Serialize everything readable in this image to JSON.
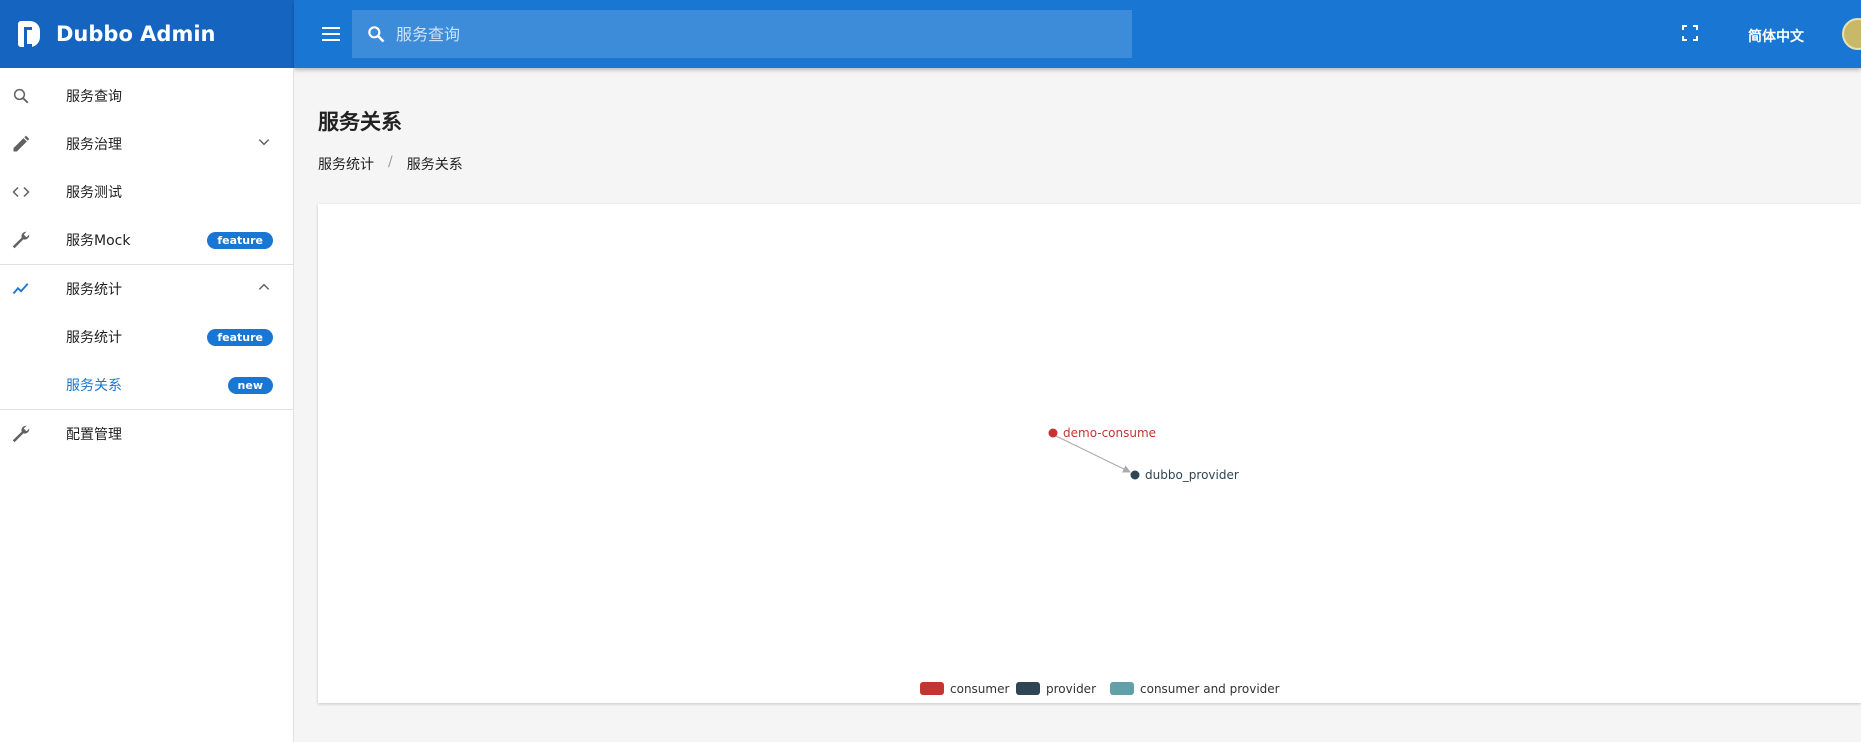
{
  "header": {
    "app_title": "Dubbo Admin",
    "search_placeholder": "服务查询",
    "language": "简体中文"
  },
  "sidebar": {
    "items": [
      {
        "label": "服务查询",
        "icon": "search-icon"
      },
      {
        "label": "服务治理",
        "icon": "pencil-icon",
        "expandable": true
      },
      {
        "label": "服务测试",
        "icon": "code-icon"
      },
      {
        "label": "服务Mock",
        "icon": "wrench-icon",
        "badge": "feature"
      },
      {
        "label": "服务统计",
        "icon": "trend-icon",
        "expanded": true
      },
      {
        "label": "服务统计",
        "badge": "feature",
        "sub": true
      },
      {
        "label": "服务关系",
        "badge": "new",
        "sub": true,
        "active": true
      },
      {
        "label": "配置管理",
        "icon": "wrench-icon"
      }
    ]
  },
  "page": {
    "title": "服务关系",
    "breadcrumb": [
      "服务统计",
      "服务关系"
    ]
  },
  "colors": {
    "consumer": "#c23531",
    "provider": "#2f4554",
    "consumer_and_provider": "#61a0a8",
    "accent": "#1976d2"
  },
  "chart_data": {
    "type": "graph",
    "nodes": [
      {
        "name": "demo-consume",
        "category": "consumer"
      },
      {
        "name": "dubbo_provider",
        "category": "provider"
      }
    ],
    "links": [
      {
        "source": "demo-consume",
        "target": "dubbo_provider"
      }
    ],
    "legend": [
      "consumer",
      "provider",
      "consumer and provider"
    ]
  }
}
